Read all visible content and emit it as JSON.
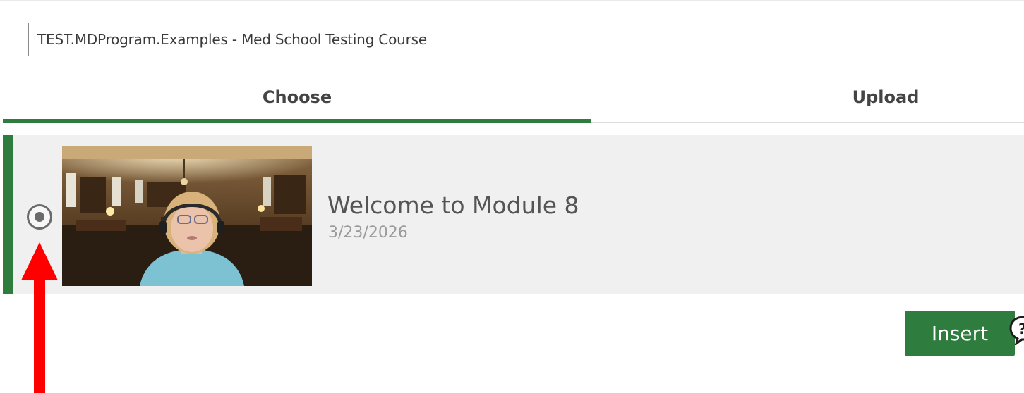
{
  "course_selector": {
    "value": "TEST.MDProgram.Examples - Med School Testing Course"
  },
  "tabs": [
    {
      "label": "Choose",
      "active": true
    },
    {
      "label": "Upload",
      "active": false
    }
  ],
  "videos": [
    {
      "title": "Welcome to Module 8",
      "date": "3/23/2026",
      "selected": true
    }
  ],
  "actions": {
    "insert_label": "Insert"
  },
  "icons": {
    "help": "help-icon",
    "radio": "radio-selected-icon",
    "annotation": "red-arrow-up-icon"
  },
  "colors": {
    "accent": "#2e7d3e",
    "annotation_arrow": "#ff0000",
    "row_background": "#f0f0f0"
  }
}
